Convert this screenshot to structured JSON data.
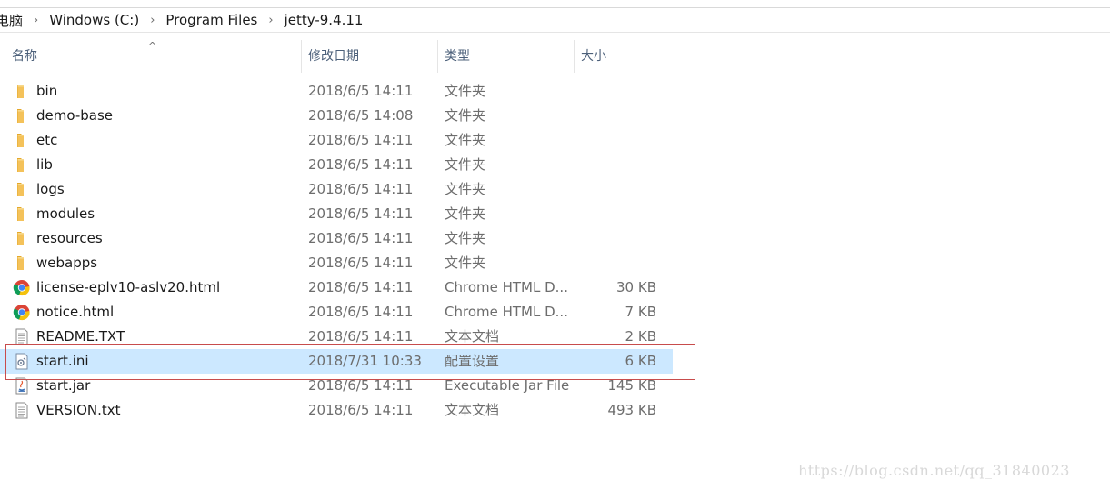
{
  "address_bar": {
    "crumbs": [
      "电脑",
      "Windows (C:)",
      "Program Files",
      "jetty-9.4.11"
    ],
    "separator": "›"
  },
  "columns": {
    "name": "名称",
    "date": "修改日期",
    "type": "类型",
    "size": "大小",
    "sort_indicator": "^"
  },
  "files": [
    {
      "name": "bin",
      "date": "2018/6/5 14:11",
      "type": "文件夹",
      "size": "",
      "icon": "folder-icon"
    },
    {
      "name": "demo-base",
      "date": "2018/6/5 14:08",
      "type": "文件夹",
      "size": "",
      "icon": "folder-icon"
    },
    {
      "name": "etc",
      "date": "2018/6/5 14:11",
      "type": "文件夹",
      "size": "",
      "icon": "folder-icon"
    },
    {
      "name": "lib",
      "date": "2018/6/5 14:11",
      "type": "文件夹",
      "size": "",
      "icon": "folder-icon"
    },
    {
      "name": "logs",
      "date": "2018/6/5 14:11",
      "type": "文件夹",
      "size": "",
      "icon": "folder-icon"
    },
    {
      "name": "modules",
      "date": "2018/6/5 14:11",
      "type": "文件夹",
      "size": "",
      "icon": "folder-icon"
    },
    {
      "name": "resources",
      "date": "2018/6/5 14:11",
      "type": "文件夹",
      "size": "",
      "icon": "folder-icon"
    },
    {
      "name": "webapps",
      "date": "2018/6/5 14:11",
      "type": "文件夹",
      "size": "",
      "icon": "folder-icon"
    },
    {
      "name": "license-eplv10-aslv20.html",
      "date": "2018/6/5 14:11",
      "type": "Chrome HTML D...",
      "size": "30 KB",
      "icon": "chrome-icon"
    },
    {
      "name": "notice.html",
      "date": "2018/6/5 14:11",
      "type": "Chrome HTML D...",
      "size": "7 KB",
      "icon": "chrome-icon"
    },
    {
      "name": "README.TXT",
      "date": "2018/6/5 14:11",
      "type": "文本文档",
      "size": "2 KB",
      "icon": "text-file-icon"
    },
    {
      "name": "start.ini",
      "date": "2018/7/31 10:33",
      "type": "配置设置",
      "size": "6 KB",
      "icon": "ini-file-icon",
      "selected": true
    },
    {
      "name": "start.jar",
      "date": "2018/6/5 14:11",
      "type": "Executable Jar File",
      "size": "145 KB",
      "icon": "jar-file-icon"
    },
    {
      "name": "VERSION.txt",
      "date": "2018/6/5 14:11",
      "type": "文本文档",
      "size": "493 KB",
      "icon": "text-file-icon"
    }
  ],
  "watermark": "https://blog.csdn.net/qq_31840023",
  "colors": {
    "selection": "#cce8ff",
    "highlight_box": "#c84c4c",
    "header_text": "#4c607a",
    "folder": "#f4c25a"
  }
}
